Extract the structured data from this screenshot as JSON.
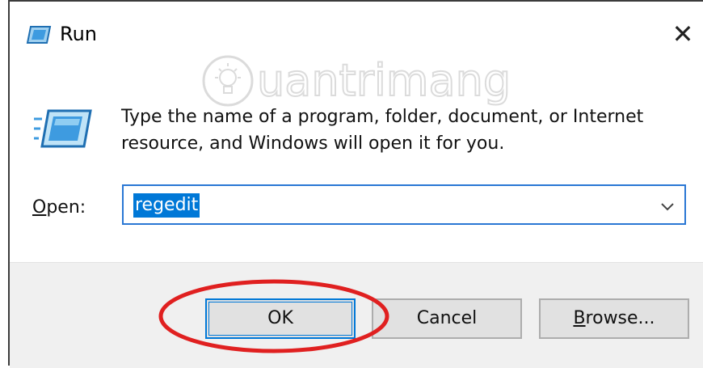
{
  "window": {
    "title": "Run",
    "close_glyph": "✕",
    "title_icon": "run-icon"
  },
  "description": "Type the name of a program, folder, document, or Internet resource, and Windows will open it for you.",
  "open_field": {
    "label_mnemonic": "O",
    "label_rest": "pen:",
    "value": "regedit",
    "dropdown_icon": "chevron-down-icon"
  },
  "buttons": {
    "ok": "OK",
    "cancel": "Cancel",
    "browse_mnemonic": "B",
    "browse_rest": "rowse..."
  },
  "watermark": {
    "text": "uantrimang",
    "icon": "lightbulb-icon"
  },
  "colors": {
    "accent": "#0078d7",
    "selection": "#0078d7",
    "annotation": "#e02020",
    "footer_bg": "#f0f0f0"
  }
}
